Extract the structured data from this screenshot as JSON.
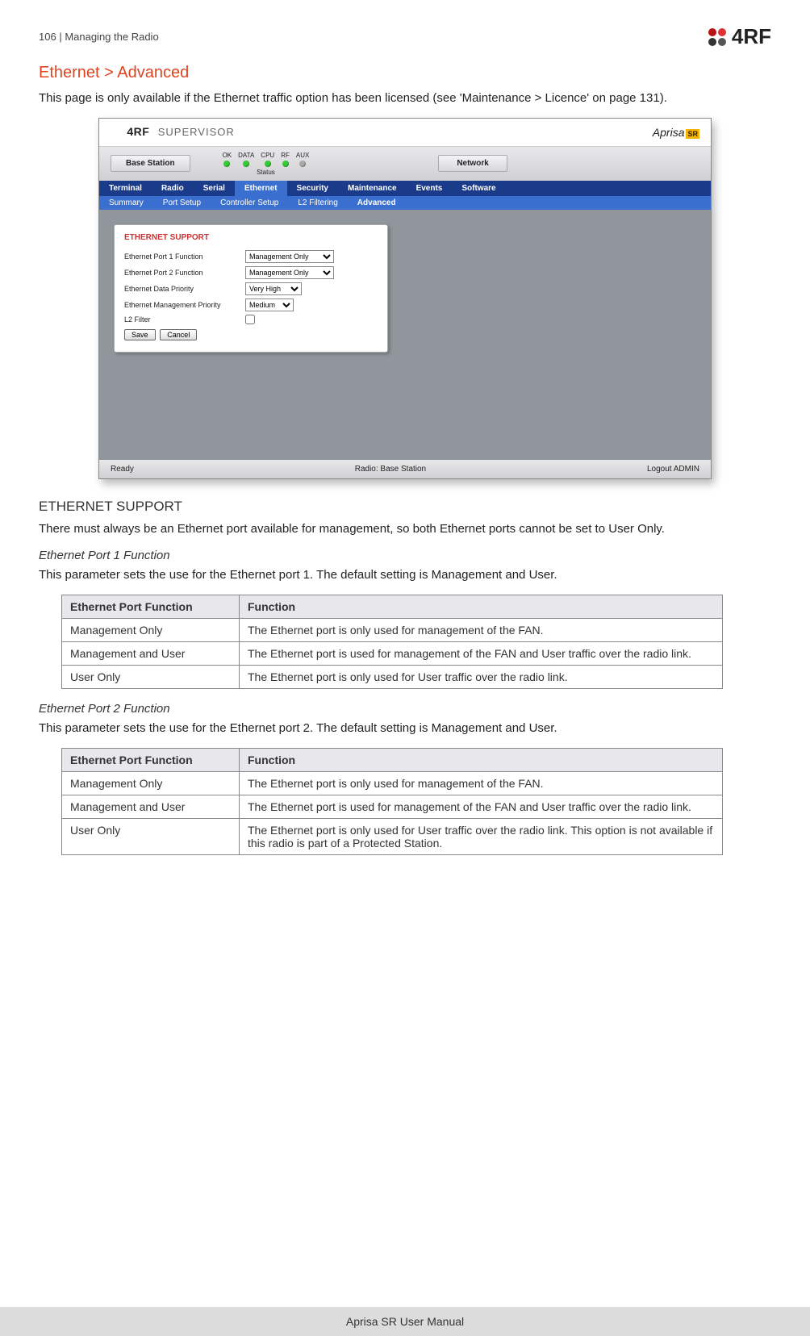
{
  "header": {
    "page_num": "106",
    "separator": "  |  ",
    "chapter": "Managing the Radio",
    "logo_text": "4RF"
  },
  "section": {
    "title": "Ethernet > Advanced",
    "intro": "This page is only available if the Ethernet traffic option has been licensed (see 'Maintenance > Licence' on page 131)."
  },
  "screenshot": {
    "logo_brand": "4RF",
    "logo_sup": "SUPERVISOR",
    "aprisa": "Aprisa",
    "aprisa_sr": "SR",
    "status": {
      "base_station": "Base Station",
      "leds": [
        "OK",
        "DATA",
        "CPU",
        "RF",
        "AUX"
      ],
      "status_label": "Status",
      "network": "Network"
    },
    "tabs": [
      "Terminal",
      "Radio",
      "Serial",
      "Ethernet",
      "Security",
      "Maintenance",
      "Events",
      "Software"
    ],
    "active_tab": "Ethernet",
    "subtabs": [
      "Summary",
      "Port Setup",
      "Controller Setup",
      "L2 Filtering",
      "Advanced"
    ],
    "active_subtab": "Advanced",
    "panel": {
      "title": "ETHERNET SUPPORT",
      "fields": {
        "port1": {
          "label": "Ethernet Port 1 Function",
          "value": "Management Only"
        },
        "port2": {
          "label": "Ethernet Port 2 Function",
          "value": "Management Only"
        },
        "data_prio": {
          "label": "Ethernet Data Priority",
          "value": "Very High"
        },
        "mgmt_prio": {
          "label": "Ethernet Management Priority",
          "value": "Medium"
        },
        "l2": {
          "label": "L2 Filter"
        }
      },
      "save": "Save",
      "cancel": "Cancel"
    },
    "footer": {
      "ready": "Ready",
      "radio": "Radio: Base Station",
      "logout": "Logout ADMIN"
    }
  },
  "ethernet_support": {
    "heading": "ETHERNET SUPPORT",
    "intro": "There must always be an Ethernet port available for management, so both Ethernet ports cannot be set to User Only.",
    "port1": {
      "title": "Ethernet Port 1 Function",
      "desc": "This parameter sets the use for the Ethernet port 1. The default setting is Management and User.",
      "cols": [
        "Ethernet Port Function",
        "Function"
      ],
      "rows": [
        [
          "Management Only",
          "The Ethernet port is only used for management of the FAN."
        ],
        [
          "Management and User",
          "The Ethernet port is used for management of the FAN and User traffic over the radio link."
        ],
        [
          "User Only",
          "The Ethernet port is only used for User traffic over the radio link."
        ]
      ]
    },
    "port2": {
      "title": "Ethernet Port 2 Function",
      "desc": "This parameter sets the use for the Ethernet port 2. The default setting is Management and User.",
      "cols": [
        "Ethernet Port Function",
        "Function"
      ],
      "rows": [
        [
          "Management Only",
          "The Ethernet port is only used for management of the FAN."
        ],
        [
          "Management and User",
          "The Ethernet port is used for management of the FAN and User traffic over the radio link."
        ],
        [
          "User Only",
          "The Ethernet port is only used for User traffic over the radio link. This option is not available if this radio is part of a Protected Station."
        ]
      ]
    }
  },
  "footer": {
    "manual": "Aprisa SR User Manual"
  }
}
